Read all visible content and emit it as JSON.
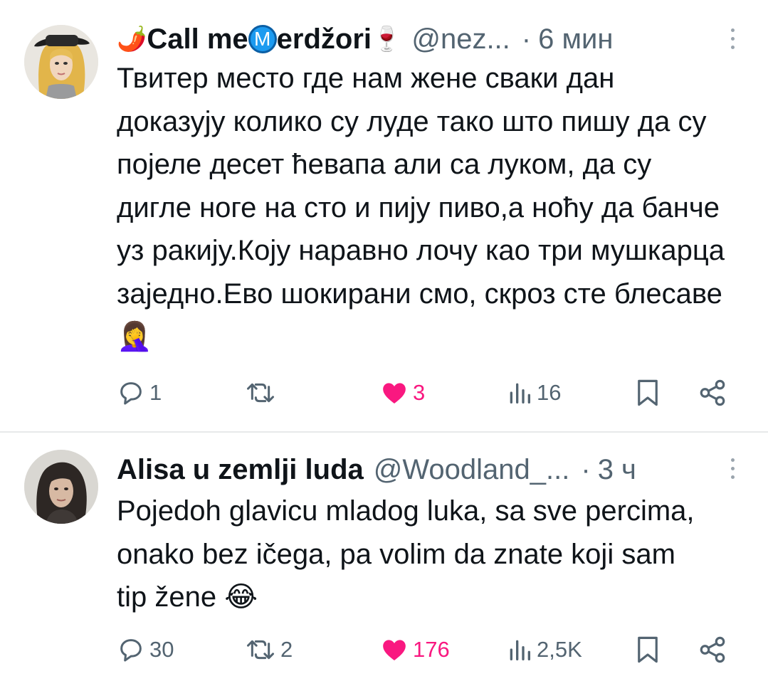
{
  "tweets": [
    {
      "author_name": "Call me ",
      "author_badge_letter": "M",
      "author_name_rest": "erdžori",
      "name_prefix_emoji": "🌶️",
      "name_suffix_emoji": "🍷",
      "handle": "@nez...",
      "separator": "·",
      "time": "6 мин",
      "text": "Твитер место где нам жене сваки дан доказују колико су луде тако што пишу да су појеле десет ћевапа али са луком, да су дигле ноге на сто и пију пиво,а ноћу да банче уз ракију.Коју наравно лочу као три мушкарца заједно.Ево шокирани смо, скроз сте блесаве",
      "text_emoji": "🤦‍♀️",
      "stats": {
        "replies": "1",
        "reposts": "",
        "likes": "3",
        "views": "16"
      }
    },
    {
      "author_name": "Alisa u zemlji luda",
      "handle": "@Woodland_...",
      "separator": "·",
      "time": "3 ч",
      "text": "Pojedoh glavicu mladog luka, sa sve percima, onako bez ičega, pa volim da znate koji sam tip žene",
      "text_emoji": "😂",
      "stats": {
        "replies": "30",
        "reposts": "2",
        "likes": "176",
        "views": "2,5K"
      }
    }
  ],
  "colors": {
    "text": "#0f1419",
    "secondary": "#536471",
    "like": "#f91880",
    "badge": "#1d9bf0",
    "divider": "#e7e9ea"
  },
  "icons": [
    "reply-icon",
    "repost-icon",
    "heart-icon",
    "views-icon",
    "bookmark-icon",
    "share-icon",
    "more-icon"
  ]
}
